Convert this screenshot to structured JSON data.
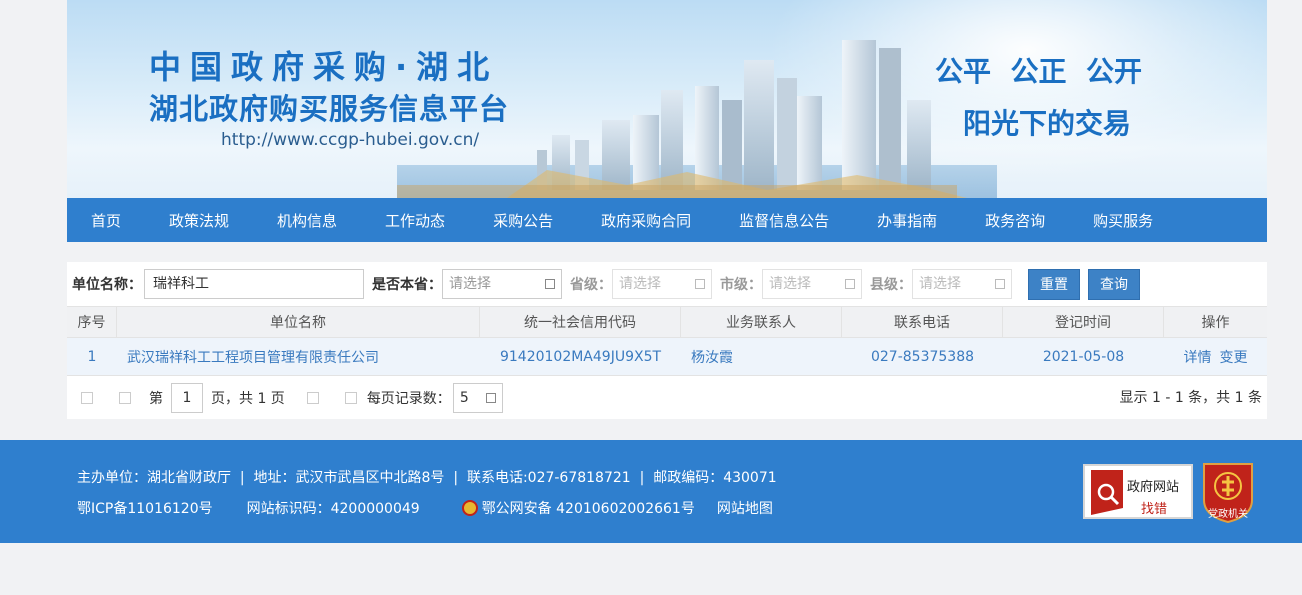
{
  "banner": {
    "title_line1": "中国政府采购·湖北",
    "title_line2": "湖北政府购买服务信息平台",
    "url": "http://www.ccgp-hubei.gov.cn/",
    "slogan_line1": "公平  公正  公开",
    "slogan_line2": "阳光下的交易"
  },
  "nav": [
    "首页",
    "政策法规",
    "机构信息",
    "工作动态",
    "采购公告",
    "政府采购合同",
    "监督信息公告",
    "办事指南",
    "政务咨询",
    "购买服务"
  ],
  "filters": {
    "unit_label": "单位名称：",
    "unit_value": "瑞祥科工",
    "is_local_label": "是否本省：",
    "is_local_placeholder": "请选择",
    "province_label": "省级：",
    "province_placeholder": "请选择",
    "city_label": "市级：",
    "city_placeholder": "请选择",
    "county_label": "县级：",
    "county_placeholder": "请选择",
    "reset_label": "重置",
    "search_label": "查询"
  },
  "table": {
    "headers": [
      "序号",
      "单位名称",
      "统一社会信用代码",
      "业务联系人",
      "联系电话",
      "登记时间",
      "操作"
    ],
    "rows": [
      {
        "index": "1",
        "name": "武汉瑞祥科工工程项目管理有限责任公司",
        "credit_code": "91420102MA49JU9X5T",
        "contact": "杨汝霞",
        "phone": "027-85375388",
        "date": "2021-05-08",
        "action_detail": "详情",
        "action_change": "变更"
      }
    ]
  },
  "pager": {
    "page_prefix": "第",
    "current_page": "1",
    "page_suffix": "页，共 1 页",
    "per_page_label": "每页记录数：",
    "per_page_value": "5",
    "summary": "显示 1 - 1 条，共 1 条"
  },
  "footer": {
    "line1": "主办单位：湖北省财政厅  |  地址：武汉市武昌区中北路8号  |  联系电话:027-67818721  |  邮政编码：430071",
    "icp": "鄂ICP备11016120号",
    "site_code": "网站标识码：4200000049",
    "police": "鄂公网安备 42010602002661号",
    "sitemap": "网站地图",
    "badge_line1": "政府网站",
    "badge_line2": "找错",
    "badge2_text": "党政机关"
  },
  "colors": {
    "primary": "#2f7fce",
    "link": "#3a7abf",
    "button": "#3d82c6"
  }
}
